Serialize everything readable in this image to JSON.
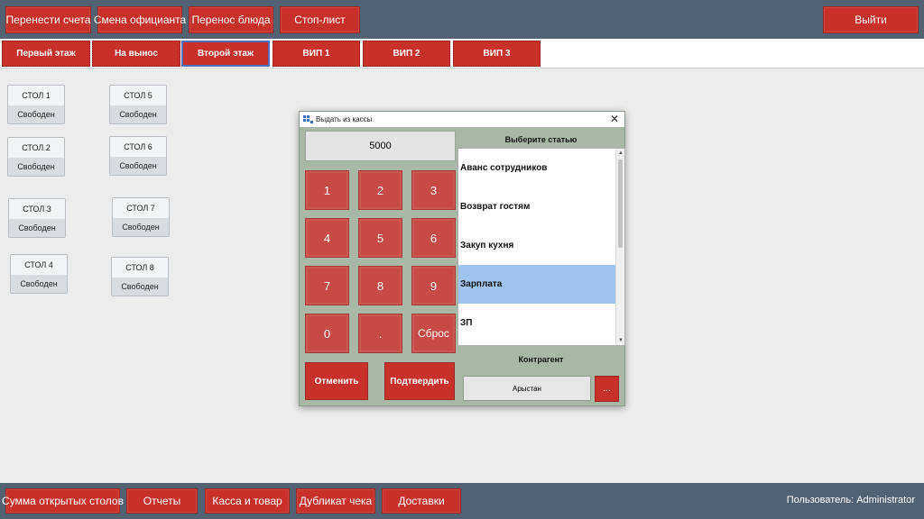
{
  "toolbar": {
    "transfer_bills": "Перенести счета",
    "change_waiter": "Смена официанта",
    "transfer_dish": "Перенос блюда",
    "stop_list": "Стоп-лист",
    "exit": "Выйти"
  },
  "tabs": [
    {
      "label": "Первый этаж",
      "active": false
    },
    {
      "label": "На вынос",
      "active": false
    },
    {
      "label": "Второй этаж",
      "active": true
    },
    {
      "label": "ВИП 1",
      "active": false
    },
    {
      "label": "ВИП 2",
      "active": false
    },
    {
      "label": "ВИП 3",
      "active": false
    }
  ],
  "tables": [
    {
      "name": "СТОЛ 1",
      "status": "Свободен"
    },
    {
      "name": "СТОЛ 2",
      "status": "Свободен"
    },
    {
      "name": "СТОЛ 3",
      "status": "Свободен"
    },
    {
      "name": "СТОЛ 4",
      "status": "Свободен"
    },
    {
      "name": "СТОЛ 5",
      "status": "Свободен"
    },
    {
      "name": "СТОЛ 6",
      "status": "Свободен"
    },
    {
      "name": "СТОЛ 7",
      "status": "Свободен"
    },
    {
      "name": "СТОЛ 8",
      "status": "Свободен"
    }
  ],
  "dialog": {
    "title": "Выдать из кассы",
    "amount": "5000",
    "keys": [
      "1",
      "2",
      "3",
      "4",
      "5",
      "6",
      "7",
      "8",
      "9",
      "0",
      ".",
      "Сброс"
    ],
    "cancel": "Отменить",
    "confirm": "Подтвердить",
    "list_header": "Выберите статью",
    "items": [
      {
        "label": "Аванс сотрудников",
        "selected": false
      },
      {
        "label": "Возврат гостям",
        "selected": false
      },
      {
        "label": "Закуп кухня",
        "selected": false
      },
      {
        "label": "Зарплата",
        "selected": true
      },
      {
        "label": "ЗП",
        "selected": false
      }
    ],
    "counterparty_label": "Контрагент",
    "counterparty_value": "Арыстан",
    "counterparty_button": "..."
  },
  "bottom": {
    "open_tables_sum": "Сумма открытых столов",
    "reports": "Отчеты",
    "cash_goods": "Касса и товар",
    "duplicate_check": "Дубликат чека",
    "delivery": "Доставки",
    "user_label": "Пользователь: Administrator"
  },
  "colors": {
    "accent_red": "#c8302a",
    "bar_slate": "#536273",
    "selected_blue": "#9cc4ec",
    "dialog_green": "#a9b8a6"
  }
}
